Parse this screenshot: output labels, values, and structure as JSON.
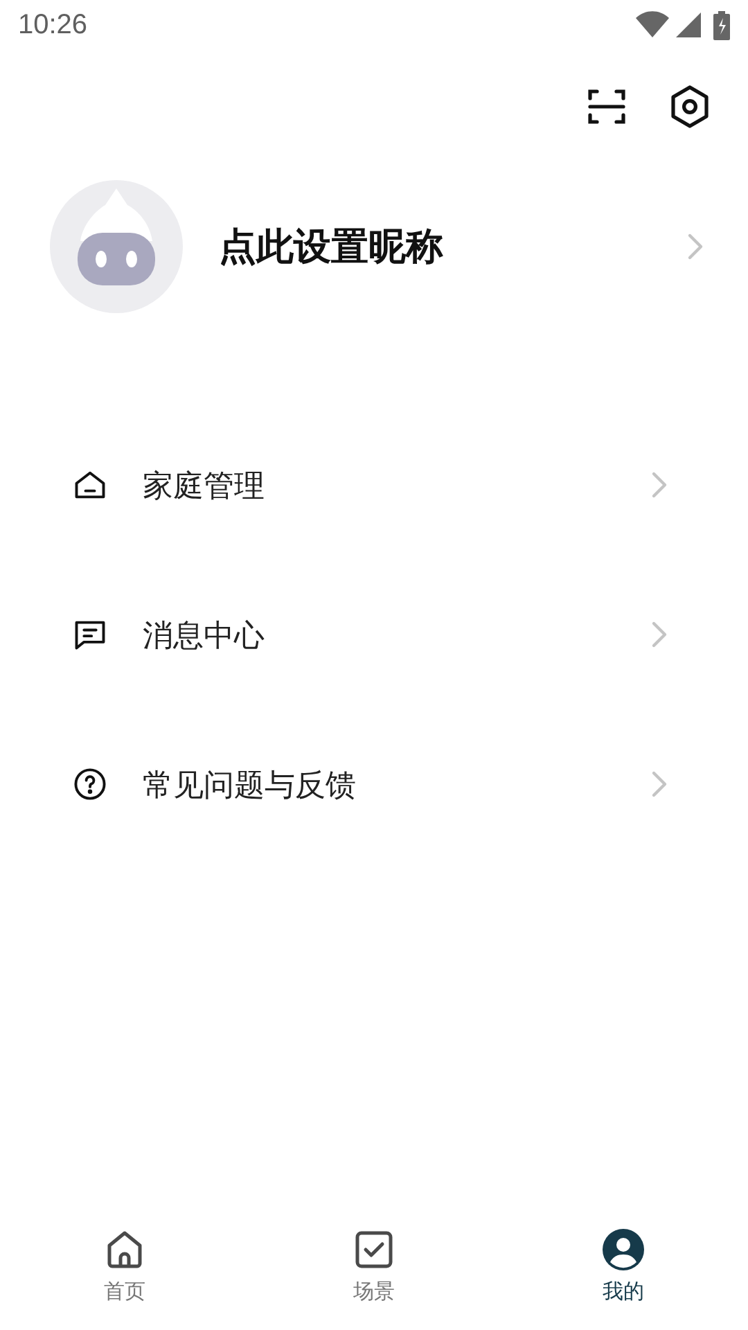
{
  "status_bar": {
    "time": "10:26"
  },
  "profile": {
    "nickname": "点此设置昵称"
  },
  "menu": [
    {
      "kind": "home",
      "label": "家庭管理"
    },
    {
      "kind": "message",
      "label": "消息中心"
    },
    {
      "kind": "help",
      "label": "常见问题与反馈"
    }
  ],
  "tabs": [
    {
      "kind": "home",
      "label": "首页",
      "selected": false
    },
    {
      "kind": "scene",
      "label": "场景",
      "selected": false
    },
    {
      "kind": "me",
      "label": "我的",
      "selected": true
    }
  ]
}
